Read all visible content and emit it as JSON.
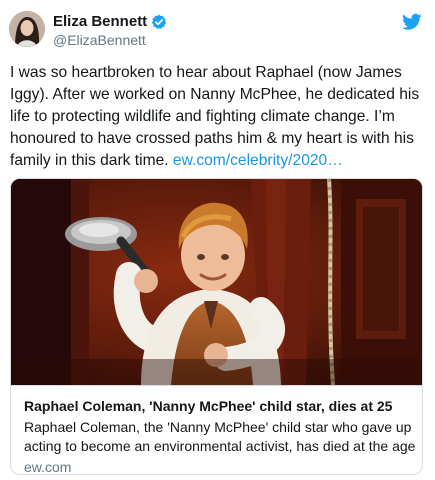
{
  "author": {
    "name": "Eliza Bennett",
    "handle": "@ElizaBennett",
    "verified": true
  },
  "tweet": {
    "text": "I was so heartbroken to hear about Raphael (now James Iggy). After we worked on Nanny McPhee, he dedicated his life to protecting wildlife and fighting climate change. I’m honoured to have crossed paths him & my heart is with his family in this dark time. ",
    "link_text": "ew.com/celebrity/2020…"
  },
  "card": {
    "title": "Raphael Coleman, 'Nanny McPhee' child star, dies at 25",
    "description": "Raphael Coleman, the 'Nanny McPhee' child star who gave up acting to become an environmental activist, has died at the age",
    "domain": "ew.com"
  },
  "icons": {
    "verified": "verified-badge-icon",
    "platform": "twitter-bird-icon"
  },
  "colors": {
    "link": "#1b95e0",
    "verified": "#1da1f2",
    "secondary_text": "#657786"
  }
}
